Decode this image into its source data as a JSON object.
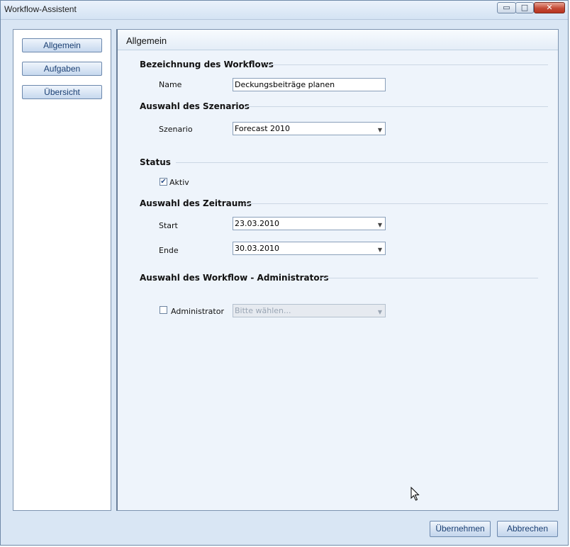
{
  "window": {
    "title": "Workflow-Assistent",
    "controls": {
      "minimize": "▭",
      "maximize": "□",
      "close": "✕"
    }
  },
  "nav": {
    "items": [
      {
        "label": "Allgemein"
      },
      {
        "label": "Aufgaben"
      },
      {
        "label": "Übersicht"
      }
    ]
  },
  "panel": {
    "title": "Allgemein",
    "workflow_section": {
      "heading": "Bezeichnung des Workflows",
      "name_label": "Name",
      "name_value": "Deckungsbeiträge planen"
    },
    "scenario_section": {
      "heading": "Auswahl des Szenarios",
      "label": "Szenario",
      "value": "Forecast 2010"
    },
    "status_section": {
      "heading": "Status",
      "aktiv_label": "Aktiv",
      "aktiv_checked": true
    },
    "period_section": {
      "heading": "Auswahl des Zeitraums",
      "start_label": "Start",
      "start_value": "23.03.2010",
      "end_label": "Ende",
      "end_value": "30.03.2010"
    },
    "admin_section": {
      "heading": "Auswahl des Workflow - Administrators",
      "checkbox_label": "Administrator",
      "checked": false,
      "placeholder": "Bitte wählen..."
    }
  },
  "footer": {
    "apply_label": "Übernehmen",
    "cancel_label": "Abbrechen"
  },
  "icons": {
    "check": "✔",
    "dropdown_arrow": "▼"
  }
}
